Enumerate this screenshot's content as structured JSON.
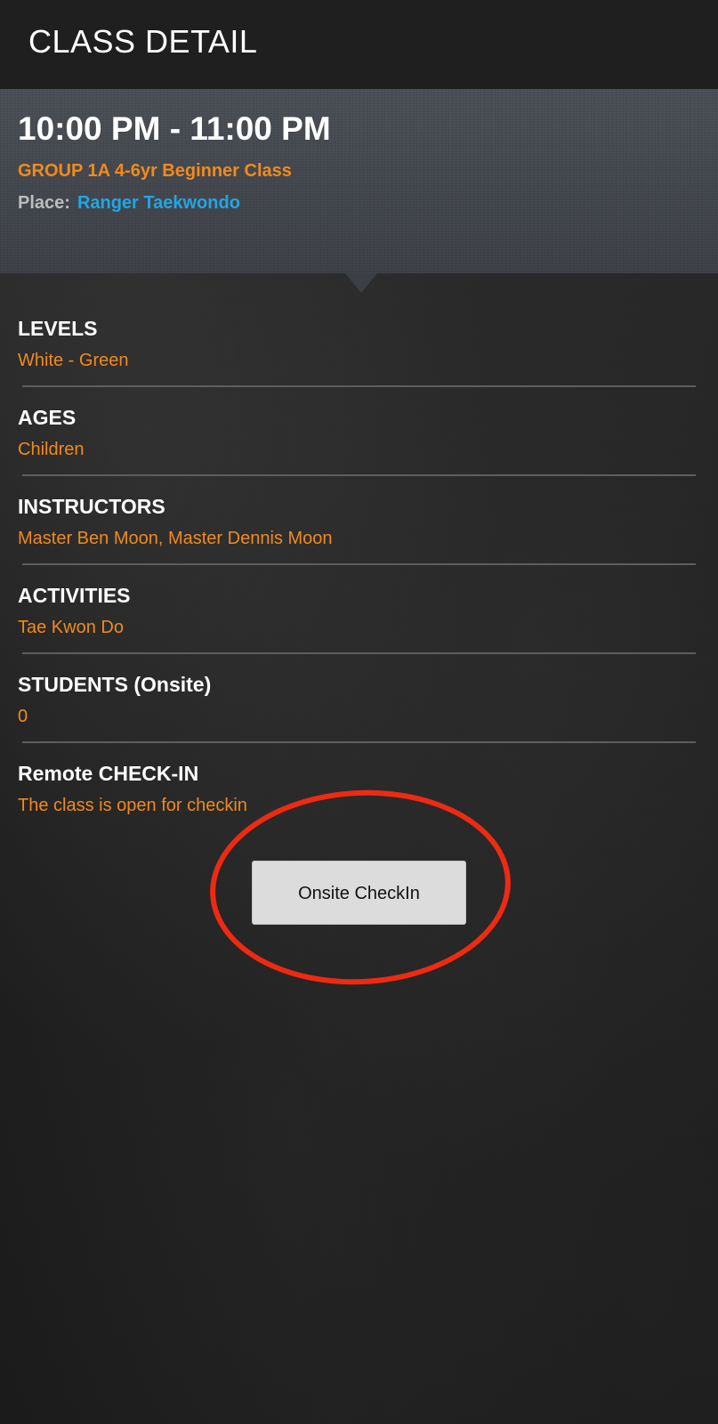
{
  "app_bar": {
    "title": "CLASS DETAIL"
  },
  "header": {
    "time_range": "10:00 PM - 11:00 PM",
    "class_name": "GROUP 1A 4-6yr Beginner Class",
    "place_label": "Place:",
    "place_value": "Ranger Taekwondo"
  },
  "sections": [
    {
      "label": "LEVELS",
      "value": "White - Green"
    },
    {
      "label": "AGES",
      "value": "Children"
    },
    {
      "label": "INSTRUCTORS",
      "value": "Master Ben Moon, Master Dennis Moon"
    },
    {
      "label": "ACTIVITIES",
      "value": "Tae Kwon Do"
    },
    {
      "label": "STUDENTS (Onsite)",
      "value": "0"
    },
    {
      "label": "Remote CHECK-IN",
      "value": "The class is open for checkin"
    }
  ],
  "checkin": {
    "button_label": "Onsite CheckIn"
  },
  "colors": {
    "accent_orange": "#f28a1b",
    "link_blue": "#1ea7e8",
    "annotation_red": "#ee2a12"
  }
}
